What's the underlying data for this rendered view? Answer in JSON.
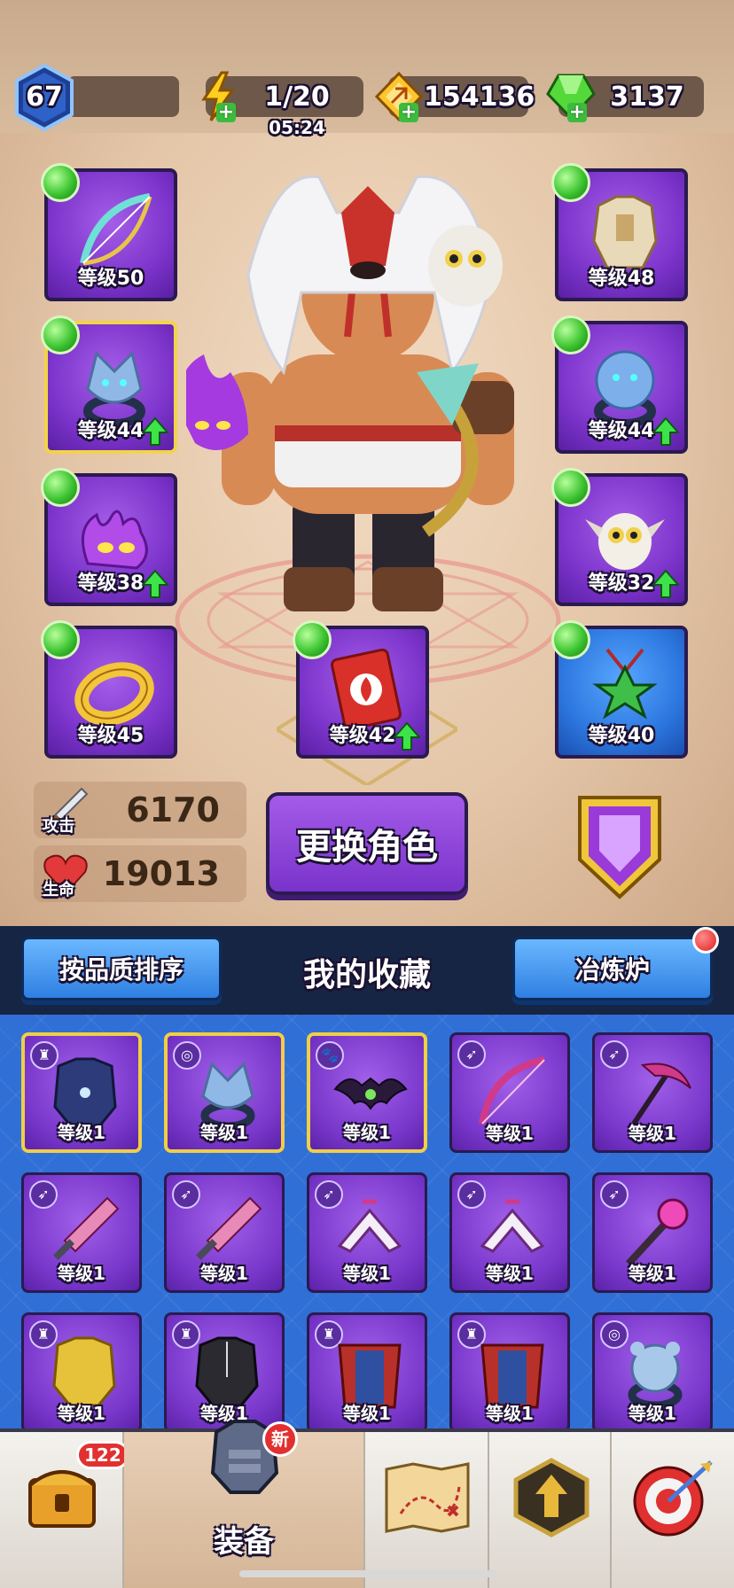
{
  "top_bar": {
    "player_level": "67",
    "energy": "1/20",
    "energy_timer": "05:24",
    "gold": "154136",
    "gems": "3137"
  },
  "equipment": {
    "weapon": {
      "level": "等级50",
      "icon": "bow-icon"
    },
    "armor": {
      "level": "等级48",
      "icon": "armor-icon"
    },
    "ring_left": {
      "level": "等级44",
      "icon": "wolf-ring-icon"
    },
    "ring_right": {
      "level": "等级44",
      "icon": "lion-ring-icon"
    },
    "pet_left": {
      "level": "等级38",
      "icon": "purple-spirit-icon"
    },
    "pet_right": {
      "level": "等级32",
      "icon": "owl-icon"
    },
    "bracelet": {
      "level": "等级45",
      "icon": "gold-bracelet-icon"
    },
    "book": {
      "level": "等级42",
      "icon": "fire-book-icon"
    },
    "amulet": {
      "level": "等级40",
      "icon": "star-amulet-icon"
    }
  },
  "stats": {
    "attack_label": "攻击",
    "attack_value": "6170",
    "hp_label": "生命",
    "hp_value": "19013"
  },
  "change_character_label": "更换角色",
  "collection": {
    "sort_button": "按品质排序",
    "title": "我的收藏",
    "smelter_button": "冶炼炉",
    "items": [
      {
        "level": "等级1",
        "icon": "dark-armor-icon",
        "category": "armor"
      },
      {
        "level": "等级1",
        "icon": "wolf-ring-icon",
        "category": "ring"
      },
      {
        "level": "等级1",
        "icon": "bat-pet-icon",
        "category": "pet"
      },
      {
        "level": "等级1",
        "icon": "pink-bow-icon",
        "category": "weapon"
      },
      {
        "level": "等级1",
        "icon": "pink-scythe-icon",
        "category": "weapon"
      },
      {
        "level": "等级1",
        "icon": "pink-sword-icon",
        "category": "weapon"
      },
      {
        "level": "等级1",
        "icon": "pink-sword-icon",
        "category": "weapon"
      },
      {
        "level": "等级1",
        "icon": "boomerang-icon",
        "category": "weapon"
      },
      {
        "level": "等级1",
        "icon": "boomerang-icon",
        "category": "weapon"
      },
      {
        "level": "等级1",
        "icon": "pink-staff-icon",
        "category": "weapon"
      },
      {
        "level": "等级1",
        "icon": "gold-armor-icon",
        "category": "armor"
      },
      {
        "level": "等级1",
        "icon": "black-vest-icon",
        "category": "armor"
      },
      {
        "level": "等级1",
        "icon": "red-cape-icon",
        "category": "armor"
      },
      {
        "level": "等级1",
        "icon": "red-cape-icon",
        "category": "armor"
      },
      {
        "level": "等级1",
        "icon": "bear-ring-icon",
        "category": "ring"
      }
    ]
  },
  "bottom_nav": {
    "chest_badge": "122",
    "equipment_label": "装备",
    "equipment_badge": "新"
  },
  "colors": {
    "purple_slot": "#7d35cc",
    "blue_slot": "#2d78e0",
    "green_gem": "#3dc431",
    "header_blue": "#2f7fe2"
  }
}
